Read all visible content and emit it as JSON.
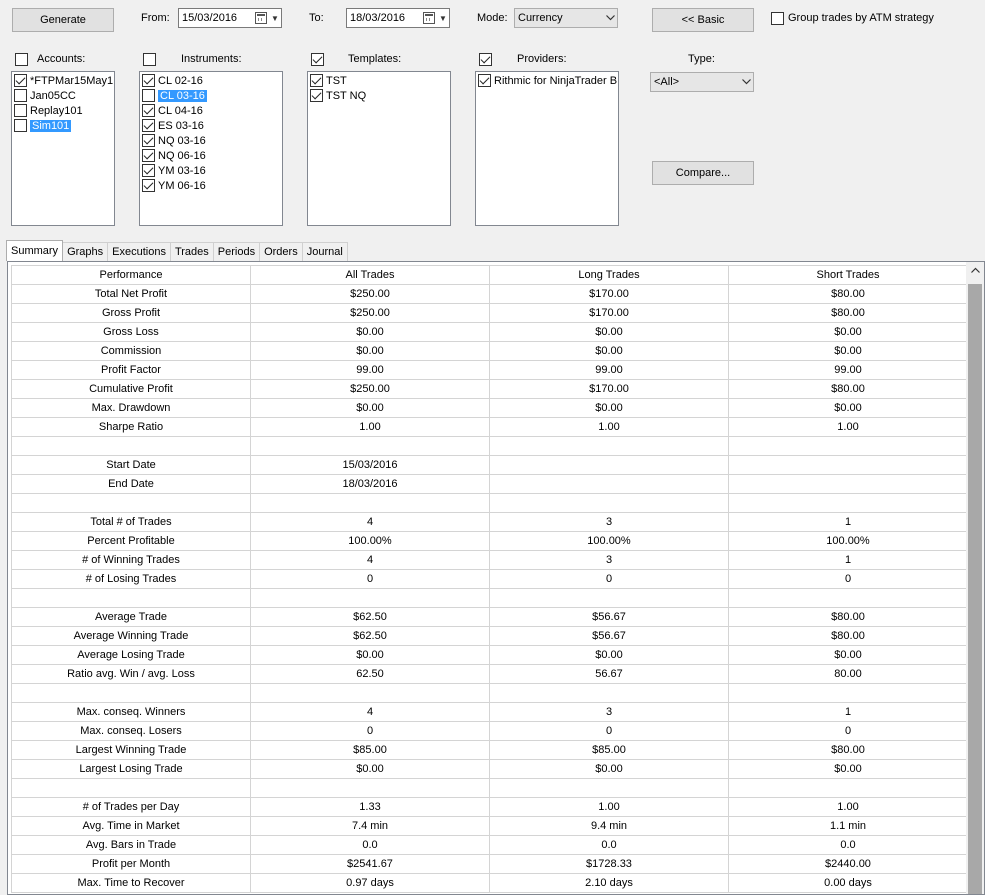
{
  "toolbar": {
    "generate_label": "Generate",
    "from_label": "From:",
    "from_date": "15/03/2016",
    "to_label": "To:",
    "to_date": "18/03/2016",
    "mode_label": "Mode:",
    "mode_value": "Currency",
    "basic_label": "<< Basic",
    "group_atm_label": "Group trades by ATM strategy",
    "type_label": "Type:",
    "type_value": "<All>",
    "compare_label": "Compare..."
  },
  "accounts": {
    "label": "Accounts:",
    "items": [
      {
        "label": "*FTPMar15May1",
        "checked": true,
        "selected": false
      },
      {
        "label": "Jan05CC",
        "checked": false,
        "selected": false
      },
      {
        "label": "Replay101",
        "checked": false,
        "selected": false
      },
      {
        "label": "Sim101",
        "checked": false,
        "selected": true
      }
    ]
  },
  "instruments": {
    "label": "Instruments:",
    "items": [
      {
        "label": "CL 02-16",
        "checked": true,
        "selected": false
      },
      {
        "label": "CL 03-16",
        "checked": false,
        "selected": true
      },
      {
        "label": "CL 04-16",
        "checked": true,
        "selected": false
      },
      {
        "label": "ES 03-16",
        "checked": true,
        "selected": false
      },
      {
        "label": "NQ 03-16",
        "checked": true,
        "selected": false
      },
      {
        "label": "NQ 06-16",
        "checked": true,
        "selected": false
      },
      {
        "label": "YM 03-16",
        "checked": true,
        "selected": false
      },
      {
        "label": "YM 06-16",
        "checked": true,
        "selected": false
      }
    ]
  },
  "templates": {
    "label": "Templates:",
    "items": [
      {
        "label": "TST",
        "checked": true,
        "selected": false
      },
      {
        "label": "TST NQ",
        "checked": true,
        "selected": false
      }
    ]
  },
  "providers": {
    "label": "Providers:",
    "items": [
      {
        "label": "Rithmic for NinjaTrader B",
        "checked": true,
        "selected": false
      }
    ]
  },
  "tabs": [
    "Summary",
    "Graphs",
    "Executions",
    "Trades",
    "Periods",
    "Orders",
    "Journal"
  ],
  "table": {
    "headers": [
      "Performance",
      "All Trades",
      "Long Trades",
      "Short Trades"
    ],
    "rows": [
      [
        "Total Net Profit",
        "$250.00",
        "$170.00",
        "$80.00"
      ],
      [
        "Gross Profit",
        "$250.00",
        "$170.00",
        "$80.00"
      ],
      [
        "Gross Loss",
        "$0.00",
        "$0.00",
        "$0.00"
      ],
      [
        "Commission",
        "$0.00",
        "$0.00",
        "$0.00"
      ],
      [
        "Profit Factor",
        "99.00",
        "99.00",
        "99.00"
      ],
      [
        "Cumulative Profit",
        "$250.00",
        "$170.00",
        "$80.00"
      ],
      [
        "Max. Drawdown",
        "$0.00",
        "$0.00",
        "$0.00"
      ],
      [
        "Sharpe Ratio",
        "1.00",
        "1.00",
        "1.00"
      ],
      [
        "",
        "",
        "",
        ""
      ],
      [
        "Start Date",
        "15/03/2016",
        "",
        ""
      ],
      [
        "End Date",
        "18/03/2016",
        "",
        ""
      ],
      [
        "",
        "",
        "",
        ""
      ],
      [
        "Total # of Trades",
        "4",
        "3",
        "1"
      ],
      [
        "Percent Profitable",
        "100.00%",
        "100.00%",
        "100.00%"
      ],
      [
        "# of Winning Trades",
        "4",
        "3",
        "1"
      ],
      [
        "# of Losing Trades",
        "0",
        "0",
        "0"
      ],
      [
        "",
        "",
        "",
        ""
      ],
      [
        "Average Trade",
        "$62.50",
        "$56.67",
        "$80.00"
      ],
      [
        "Average Winning Trade",
        "$62.50",
        "$56.67",
        "$80.00"
      ],
      [
        "Average Losing Trade",
        "$0.00",
        "$0.00",
        "$0.00"
      ],
      [
        "Ratio avg. Win / avg. Loss",
        "62.50",
        "56.67",
        "80.00"
      ],
      [
        "",
        "",
        "",
        ""
      ],
      [
        "Max. conseq. Winners",
        "4",
        "3",
        "1"
      ],
      [
        "Max. conseq. Losers",
        "0",
        "0",
        "0"
      ],
      [
        "Largest Winning Trade",
        "$85.00",
        "$85.00",
        "$80.00"
      ],
      [
        "Largest Losing Trade",
        "$0.00",
        "$0.00",
        "$0.00"
      ],
      [
        "",
        "",
        "",
        ""
      ],
      [
        "# of Trades per Day",
        "1.33",
        "1.00",
        "1.00"
      ],
      [
        "Avg. Time in Market",
        "7.4 min",
        "9.4 min",
        "1.1 min"
      ],
      [
        "Avg. Bars in Trade",
        "0.0",
        "0.0",
        "0.0"
      ],
      [
        "Profit per Month",
        "$2541.67",
        "$1728.33",
        "$2440.00"
      ],
      [
        "Max. Time to Recover",
        "0.97 days",
        "2.10 days",
        "0.00 days"
      ]
    ]
  },
  "colors": {
    "selection": "#3399ff",
    "window_bg": "#f0f0f0",
    "scroll_thumb": "#a8a8a8"
  }
}
